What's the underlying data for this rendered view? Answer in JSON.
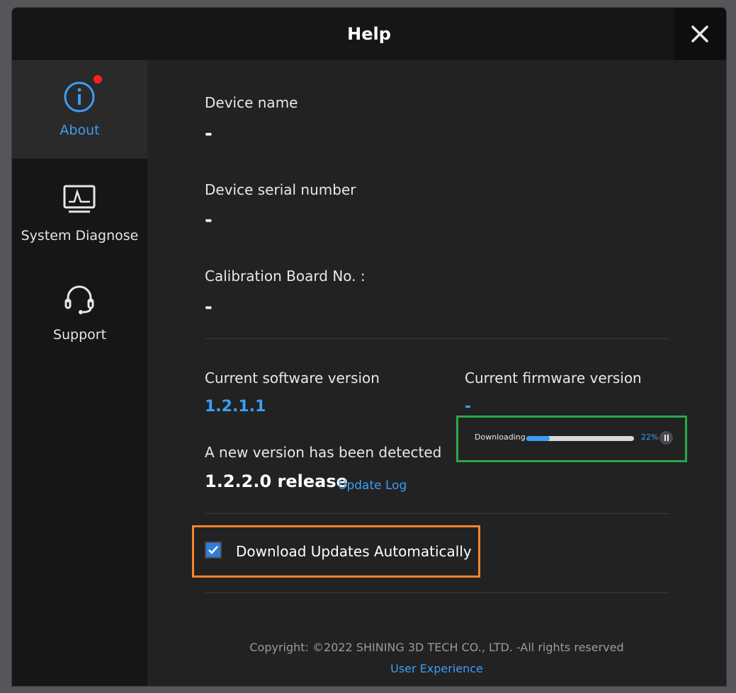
{
  "window": {
    "title": "Help",
    "close_icon": "close-icon"
  },
  "sidebar": {
    "items": [
      {
        "label": "About",
        "icon": "info-icon",
        "active": true,
        "notification": true
      },
      {
        "label": "System Diagnose",
        "icon": "monitor-waveform-icon",
        "active": false
      },
      {
        "label": "Support",
        "icon": "headset-icon",
        "active": false
      }
    ]
  },
  "about": {
    "device_name_label": "Device name",
    "device_name_value": "-",
    "serial_label": "Device serial number",
    "serial_value": "-",
    "calibration_label": "Calibration Board No. :",
    "calibration_value": "-",
    "software_version_label": "Current software version",
    "software_version_value": "1.2.1.1",
    "firmware_version_label": "Current firmware version",
    "firmware_version_value": "-",
    "new_version_label": "A new version has been detected",
    "new_version_value": "1.2.2.0 release",
    "update_log_label": "Update Log",
    "download": {
      "label": "Downloading",
      "progress_percent": 22,
      "progress_text": "22%",
      "pause_icon": "pause-icon"
    },
    "auto_download_label": "Download Updates Automatically",
    "auto_download_checked": true
  },
  "footer": {
    "copyright": "Copyright: ©2022 SHINING 3D TECH CO., LTD. -All rights reserved",
    "user_experience_label": "User Experience"
  },
  "colors": {
    "accent": "#3d9df2",
    "notification": "#ff1e1e",
    "highlight_green": "#2aa84a",
    "highlight_orange": "#f6852b"
  }
}
